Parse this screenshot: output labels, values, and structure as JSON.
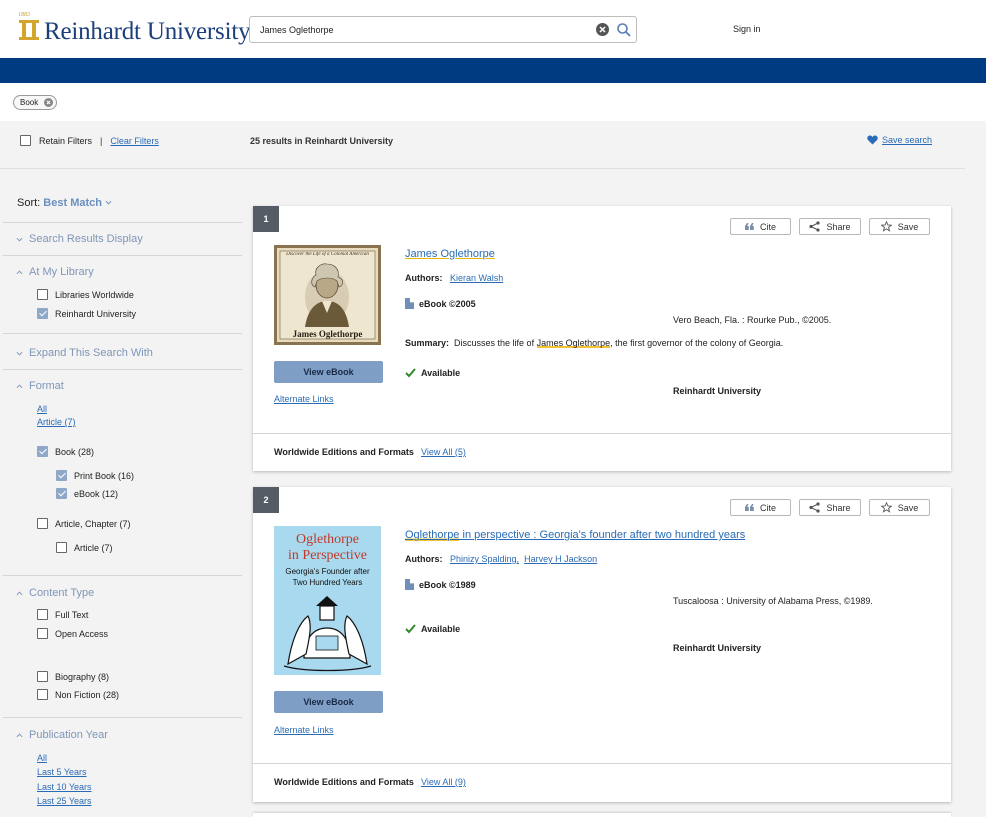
{
  "header": {
    "logo_year": "1883",
    "logo_text": "Reinhardt University",
    "search_value": "James Oglethorpe",
    "sign_in": "Sign in"
  },
  "active_chip": "Book",
  "filter_bar": {
    "retain_filters": "Retain Filters",
    "separator": "|",
    "clear_filters": "Clear Filters",
    "results_count": "25 results in Reinhardt University",
    "save_search": "Save search"
  },
  "sidebar": {
    "sort_label": "Sort:",
    "sort_value": "Best Match",
    "search_results_display": "Search Results Display",
    "at_my_library": "At My Library",
    "libraries_worldwide": "Libraries Worldwide",
    "reinhardt_university": "Reinhardt University",
    "expand_search": "Expand This Search With",
    "format": "Format",
    "format_all": "All",
    "format_article": "Article (7)",
    "book": "Book (28)",
    "print_book": "Print Book (16)",
    "ebook": "eBook (12)",
    "article_chapter": "Article, Chapter (7)",
    "article": "Article (7)",
    "content_type": "Content Type",
    "full_text": "Full Text",
    "open_access": "Open Access",
    "biography": "Biography (8)",
    "non_fiction": "Non Fiction (28)",
    "publication_year": "Publication Year",
    "year_all": "All",
    "last5": "Last 5 Years",
    "last10": "Last 10 Years",
    "last25": "Last 25 Years"
  },
  "actions": {
    "cite": "Cite",
    "share": "Share",
    "save": "Save"
  },
  "results": [
    {
      "number": "1",
      "cover_top_text": "Discover the Life of a Colonial American",
      "cover_bottom_text": "James Oglethorpe",
      "title": "James Oglethorpe",
      "authors_label": "Authors:",
      "authors": [
        "Kieran Walsh"
      ],
      "format": "eBook ©2005",
      "publisher": "Vero Beach, Fla. : Rourke Pub., ©2005.",
      "summary_label": "Summary:",
      "summary_pre": "Discusses the life of ",
      "summary_mark": "James Oglethorpe",
      "summary_post": ", the first governor of the colony of Georgia.",
      "availability": "Available",
      "library": "Reinhardt University",
      "view_button": "View eBook",
      "alt_links": "Alternate Links",
      "editions_label": "Worldwide Editions and Formats",
      "editions_link": "View All (5)"
    },
    {
      "number": "2",
      "cover_title_1": "Oglethorpe",
      "cover_title_2": "in Perspective",
      "cover_sub_1": "Georgia's Founder after",
      "cover_sub_2": "Two Hundred Years",
      "title_mark": "Oglethorpe",
      "title_rest": " in perspective : Georgia's founder after two hundred years",
      "authors_label": "Authors:",
      "authors": [
        "Phinizy Spalding,",
        "Harvey H Jackson"
      ],
      "format": "eBook ©1989",
      "publisher": "Tuscaloosa : University of Alabama Press, ©1989.",
      "availability": "Available",
      "library": "Reinhardt University",
      "view_button": "View eBook",
      "alt_links": "Alternate Links",
      "editions_label": "Worldwide Editions and Formats",
      "editions_link": "View All (9)"
    }
  ],
  "colors": {
    "brand_navy": "#003b82",
    "accent_blue": "#7f9ec6",
    "link": "#2a6bb5",
    "available_green": "#2e8b2e"
  }
}
